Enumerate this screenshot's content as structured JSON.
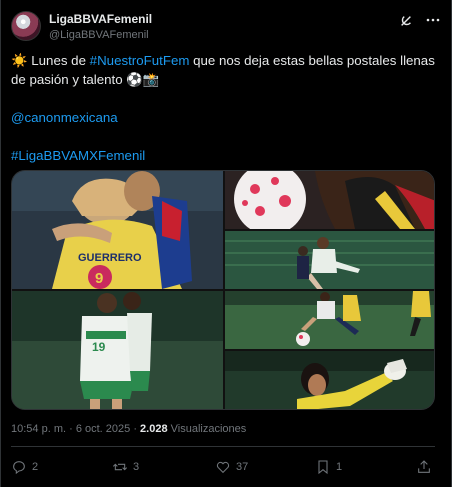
{
  "tweet": {
    "author_name": "LigaBBVAFemenil",
    "author_handle": "@LigaBBVAFemenil",
    "text_emoji_start": "☀️",
    "text_part1": " Lunes de ",
    "text_hashtag1": "#NuestroFutFem",
    "text_part2": " que nos deja estas bellas postales llenas",
    "text_line2": "de pasión y talento ",
    "text_emoji_end": "⚽📸",
    "mention": "@canonmexicana",
    "hashtag2": "#LigaBBVAMXFemenil"
  },
  "media": {
    "photos": [
      {
        "label": "Players embracing"
      },
      {
        "label": "Ball close-up"
      },
      {
        "label": "Match action 1"
      },
      {
        "label": "Players celebrating"
      },
      {
        "label": "Match action 2"
      },
      {
        "label": "Goalkeeper"
      }
    ],
    "jersey_text": "GUERRERO",
    "jersey_number": "9"
  },
  "meta": {
    "time": "10:54 p. m.",
    "separator": " · ",
    "date": "6 oct. 2025",
    "views_count": "2.028",
    "views_label": " Visualizaciones"
  },
  "actions": {
    "replies": "2",
    "reposts": "3",
    "likes": "37",
    "bookmarks": "1"
  },
  "icons": {
    "grok": "grok-icon",
    "more": "more-icon",
    "reply": "reply-icon",
    "repost": "repost-icon",
    "like": "heart-icon",
    "bookmark": "bookmark-icon",
    "share": "share-icon"
  },
  "colors": {
    "background": "#000000",
    "text": "#e7e9ea",
    "muted": "#71767b",
    "link": "#1d9bf0",
    "border": "#2f3336"
  }
}
